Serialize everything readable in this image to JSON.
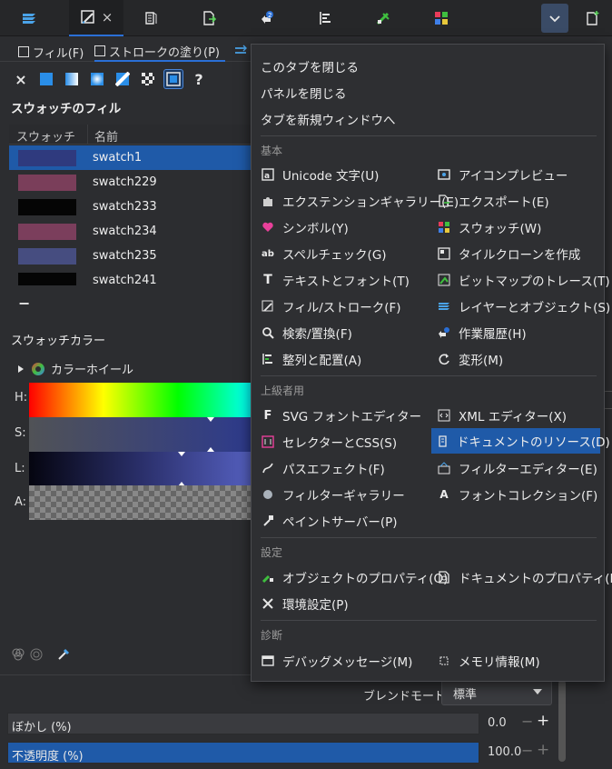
{
  "tabs": [
    {
      "icon": "layers-icon"
    },
    {
      "icon": "fill-stroke-icon",
      "close": "×"
    },
    {
      "icon": "document-resources-icon"
    },
    {
      "icon": "export-icon"
    },
    {
      "icon": "undo-history-icon"
    },
    {
      "icon": "align-icon"
    },
    {
      "icon": "bitmap-trace-icon"
    },
    {
      "icon": "swatches-icon"
    }
  ],
  "fill_tab": "フィル(F)",
  "stroke_tab": "ストロークの塗り(P)",
  "paint_unknown": "?",
  "swatch_fill_title": "スウォッチのフィル",
  "list_headers": {
    "swatch": "スウォッチ",
    "name": "名前"
  },
  "swatches": [
    {
      "name": "swatch1",
      "color": "#2f3a7e"
    },
    {
      "name": "swatch229",
      "color": "#7a3e5a"
    },
    {
      "name": "swatch233",
      "color": "#050505"
    },
    {
      "name": "swatch234",
      "color": "#7b3e5c"
    },
    {
      "name": "swatch235",
      "color": "#464d80"
    },
    {
      "name": "swatch241",
      "color": "#050505"
    }
  ],
  "remove_button": "−",
  "swatch_color_title": "スウォッチカラー",
  "color_mode": "カラーホイール",
  "slider_labels": {
    "h": "H:",
    "s": "S:",
    "l": "L:",
    "a": "A:"
  },
  "menu": {
    "top_items": [
      "このタブを閉じる",
      "パネルを閉じる",
      "タブを新規ウィンドウへ"
    ],
    "sections": {
      "basic": "基本",
      "advanced": "上級者用",
      "settings": "設定",
      "diagnostics": "診断"
    },
    "basic_left": [
      {
        "label": "Unicode 文字(U)",
        "icon": "unicode-icon"
      },
      {
        "label": "エクステンションギャラリー(E)",
        "icon": "puzzle-icon"
      },
      {
        "label": "シンボル(Y)",
        "icon": "heart-icon"
      },
      {
        "label": "スペルチェック(G)",
        "icon": "spellcheck-icon"
      },
      {
        "label": "テキストとフォント(T)",
        "icon": "text-icon"
      },
      {
        "label": "フィル/ストローク(F)",
        "icon": "fill-stroke-icon"
      },
      {
        "label": "検索/置換(F)",
        "icon": "search-icon"
      },
      {
        "label": "整列と配置(A)",
        "icon": "align-icon"
      }
    ],
    "basic_right": [
      {
        "label": "アイコンプレビュー",
        "icon": "icon-preview-icon"
      },
      {
        "label": "エクスポート(E)",
        "icon": "export-icon"
      },
      {
        "label": "スウォッチ(W)",
        "icon": "swatches-icon"
      },
      {
        "label": "タイルクローンを作成",
        "icon": "tile-clone-icon"
      },
      {
        "label": "ビットマップのトレース(T)",
        "icon": "bitmap-trace-icon"
      },
      {
        "label": "レイヤーとオブジェクト(S)",
        "icon": "layers-icon"
      },
      {
        "label": "作業履歴(H)",
        "icon": "undo-history-icon"
      },
      {
        "label": "変形(M)",
        "icon": "transform-icon"
      }
    ],
    "advanced_left": [
      {
        "label": "SVG フォントエディター",
        "icon": "svg-font-icon"
      },
      {
        "label": "セレクターとCSS(S)",
        "icon": "css-icon"
      },
      {
        "label": "パスエフェクト(F)",
        "icon": "path-effect-icon"
      },
      {
        "label": "フィルターギャラリー",
        "icon": "filter-gallery-icon"
      },
      {
        "label": "ペイントサーバー(P)",
        "icon": "paint-server-icon"
      }
    ],
    "advanced_right": [
      {
        "label": "XML エディター(X)",
        "icon": "xml-icon"
      },
      {
        "label": "ドキュメントのリソース(D)",
        "icon": "document-resources-icon",
        "highlighted": true
      },
      {
        "label": "フィルターエディター(E)",
        "icon": "filter-editor-icon"
      },
      {
        "label": "フォントコレクション(F)",
        "icon": "font-collection-icon"
      }
    ],
    "settings_left": [
      {
        "label": "オブジェクトのプロパティ(O)",
        "icon": "object-properties-icon"
      },
      {
        "label": "環境設定(P)",
        "icon": "preferences-icon"
      }
    ],
    "settings_right": [
      {
        "label": "ドキュメントのプロパティ(D)",
        "icon": "document-properties-icon"
      }
    ],
    "diag_left": [
      {
        "label": "デバッグメッセージ(M)",
        "icon": "debug-icon"
      }
    ],
    "diag_right": [
      {
        "label": "メモリ情報(M)",
        "icon": "memory-icon"
      }
    ]
  },
  "blend_mode_label": "ブレンドモード:",
  "blend_mode_value": "標準",
  "blur": {
    "label": "ぼかし (%)",
    "value": "0.0"
  },
  "opacity": {
    "label": "不透明度 (%)",
    "value": "100.0",
    "fraction": 1.0
  },
  "colors": {
    "accent": "#1f5aa8",
    "highlight": "#2a6fd6"
  }
}
